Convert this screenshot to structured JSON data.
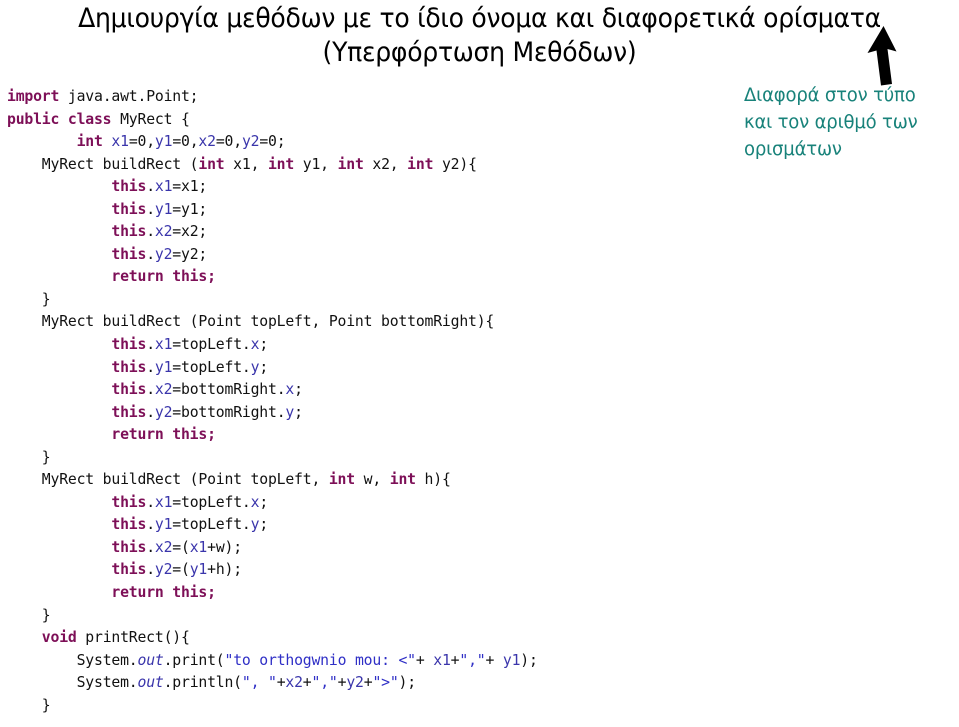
{
  "slide": {
    "title": {
      "line1": "Δημιουργία μεθόδων με το ίδιο όνομα και διαφορετικά ορίσματα",
      "line2": "(Υπερφόρτωση Μεθόδων)"
    },
    "annotation": {
      "line1": "Διαφορά στον τύπο",
      "line2": "και τον αριθμό των",
      "line3": "ορισμάτων",
      "color": "#18827a"
    },
    "arrow": {
      "icon": "arrow-up-icon",
      "color": "#000000"
    }
  },
  "code": {
    "language": "java",
    "colors": {
      "keyword": "#7d0f57",
      "variable": "#3a35ab",
      "string": "#2f2fc6",
      "plain": "#111111"
    },
    "lines": [
      {
        "indent": 0,
        "tokens": [
          {
            "t": "kw",
            "v": "import"
          },
          {
            "t": "plain",
            "v": " java.awt.Point;"
          }
        ]
      },
      {
        "indent": 0,
        "tokens": [
          {
            "t": "kw",
            "v": "public class"
          },
          {
            "t": "plain",
            "v": " MyRect {"
          }
        ]
      },
      {
        "indent": 2,
        "tokens": [
          {
            "t": "kw",
            "v": "int"
          },
          {
            "t": "plain",
            "v": " "
          },
          {
            "t": "var",
            "v": "x1"
          },
          {
            "t": "plain",
            "v": "=0,"
          },
          {
            "t": "var",
            "v": "y1"
          },
          {
            "t": "plain",
            "v": "=0,"
          },
          {
            "t": "var",
            "v": "x2"
          },
          {
            "t": "plain",
            "v": "=0,"
          },
          {
            "t": "var",
            "v": "y2"
          },
          {
            "t": "plain",
            "v": "=0;"
          }
        ]
      },
      {
        "indent": 1,
        "tokens": [
          {
            "t": "plain",
            "v": "MyRect buildRect ("
          },
          {
            "t": "kw",
            "v": "int"
          },
          {
            "t": "plain",
            "v": " x1, "
          },
          {
            "t": "kw",
            "v": "int"
          },
          {
            "t": "plain",
            "v": " y1, "
          },
          {
            "t": "kw",
            "v": "int"
          },
          {
            "t": "plain",
            "v": " x2, "
          },
          {
            "t": "kw",
            "v": "int"
          },
          {
            "t": "plain",
            "v": " y2){"
          }
        ]
      },
      {
        "indent": 3,
        "tokens": [
          {
            "t": "kw",
            "v": "this"
          },
          {
            "t": "plain",
            "v": "."
          },
          {
            "t": "var",
            "v": "x1"
          },
          {
            "t": "plain",
            "v": "=x1;"
          }
        ]
      },
      {
        "indent": 3,
        "tokens": [
          {
            "t": "kw",
            "v": "this"
          },
          {
            "t": "plain",
            "v": "."
          },
          {
            "t": "var",
            "v": "y1"
          },
          {
            "t": "plain",
            "v": "=y1;"
          }
        ]
      },
      {
        "indent": 3,
        "tokens": [
          {
            "t": "kw",
            "v": "this"
          },
          {
            "t": "plain",
            "v": "."
          },
          {
            "t": "var",
            "v": "x2"
          },
          {
            "t": "plain",
            "v": "=x2;"
          }
        ]
      },
      {
        "indent": 3,
        "tokens": [
          {
            "t": "kw",
            "v": "this"
          },
          {
            "t": "plain",
            "v": "."
          },
          {
            "t": "var",
            "v": "y2"
          },
          {
            "t": "plain",
            "v": "=y2;"
          }
        ]
      },
      {
        "indent": 3,
        "tokens": [
          {
            "t": "kw",
            "v": "return this;"
          }
        ]
      },
      {
        "indent": 1,
        "tokens": [
          {
            "t": "plain",
            "v": "}"
          }
        ]
      },
      {
        "indent": 1,
        "tokens": [
          {
            "t": "plain",
            "v": "MyRect buildRect (Point topLeft, Point bottomRight){"
          }
        ]
      },
      {
        "indent": 3,
        "tokens": [
          {
            "t": "kw",
            "v": "this"
          },
          {
            "t": "plain",
            "v": "."
          },
          {
            "t": "var",
            "v": "x1"
          },
          {
            "t": "plain",
            "v": "=topLeft."
          },
          {
            "t": "var",
            "v": "x"
          },
          {
            "t": "plain",
            "v": ";"
          }
        ]
      },
      {
        "indent": 3,
        "tokens": [
          {
            "t": "kw",
            "v": "this"
          },
          {
            "t": "plain",
            "v": "."
          },
          {
            "t": "var",
            "v": "y1"
          },
          {
            "t": "plain",
            "v": "=topLeft."
          },
          {
            "t": "var",
            "v": "y"
          },
          {
            "t": "plain",
            "v": ";"
          }
        ]
      },
      {
        "indent": 3,
        "tokens": [
          {
            "t": "kw",
            "v": "this"
          },
          {
            "t": "plain",
            "v": "."
          },
          {
            "t": "var",
            "v": "x2"
          },
          {
            "t": "plain",
            "v": "=bottomRight."
          },
          {
            "t": "var",
            "v": "x"
          },
          {
            "t": "plain",
            "v": ";"
          }
        ]
      },
      {
        "indent": 3,
        "tokens": [
          {
            "t": "kw",
            "v": "this"
          },
          {
            "t": "plain",
            "v": "."
          },
          {
            "t": "var",
            "v": "y2"
          },
          {
            "t": "plain",
            "v": "=bottomRight."
          },
          {
            "t": "var",
            "v": "y"
          },
          {
            "t": "plain",
            "v": ";"
          }
        ]
      },
      {
        "indent": 3,
        "tokens": [
          {
            "t": "kw",
            "v": "return this;"
          }
        ]
      },
      {
        "indent": 1,
        "tokens": [
          {
            "t": "plain",
            "v": "}"
          }
        ]
      },
      {
        "indent": 1,
        "tokens": [
          {
            "t": "plain",
            "v": "MyRect buildRect (Point topLeft, "
          },
          {
            "t": "kw",
            "v": "int"
          },
          {
            "t": "plain",
            "v": " w, "
          },
          {
            "t": "kw",
            "v": "int"
          },
          {
            "t": "plain",
            "v": " h){"
          }
        ]
      },
      {
        "indent": 3,
        "tokens": [
          {
            "t": "kw",
            "v": "this"
          },
          {
            "t": "plain",
            "v": "."
          },
          {
            "t": "var",
            "v": "x1"
          },
          {
            "t": "plain",
            "v": "=topLeft."
          },
          {
            "t": "var",
            "v": "x"
          },
          {
            "t": "plain",
            "v": ";"
          }
        ]
      },
      {
        "indent": 3,
        "tokens": [
          {
            "t": "kw",
            "v": "this"
          },
          {
            "t": "plain",
            "v": "."
          },
          {
            "t": "var",
            "v": "y1"
          },
          {
            "t": "plain",
            "v": "=topLeft."
          },
          {
            "t": "var",
            "v": "y"
          },
          {
            "t": "plain",
            "v": ";"
          }
        ]
      },
      {
        "indent": 3,
        "tokens": [
          {
            "t": "kw",
            "v": "this"
          },
          {
            "t": "plain",
            "v": "."
          },
          {
            "t": "var",
            "v": "x2"
          },
          {
            "t": "plain",
            "v": "=("
          },
          {
            "t": "var",
            "v": "x1"
          },
          {
            "t": "plain",
            "v": "+w);"
          }
        ]
      },
      {
        "indent": 3,
        "tokens": [
          {
            "t": "kw",
            "v": "this"
          },
          {
            "t": "plain",
            "v": "."
          },
          {
            "t": "var",
            "v": "y2"
          },
          {
            "t": "plain",
            "v": "=("
          },
          {
            "t": "var",
            "v": "y1"
          },
          {
            "t": "plain",
            "v": "+h);"
          }
        ]
      },
      {
        "indent": 3,
        "tokens": [
          {
            "t": "kw",
            "v": "return this;"
          }
        ]
      },
      {
        "indent": 1,
        "tokens": [
          {
            "t": "plain",
            "v": "}"
          }
        ]
      },
      {
        "indent": 1,
        "tokens": [
          {
            "t": "kw",
            "v": "void"
          },
          {
            "t": "plain",
            "v": " printRect(){"
          }
        ]
      },
      {
        "indent": 2,
        "tokens": [
          {
            "t": "plain",
            "v": "System."
          },
          {
            "t": "em",
            "v": "out"
          },
          {
            "t": "plain",
            "v": ".print("
          },
          {
            "t": "str",
            "v": "\"to orthogwnio mou: <\""
          },
          {
            "t": "plain",
            "v": "+ "
          },
          {
            "t": "var",
            "v": "x1"
          },
          {
            "t": "plain",
            "v": "+"
          },
          {
            "t": "str",
            "v": "\",\""
          },
          {
            "t": "plain",
            "v": "+ "
          },
          {
            "t": "var",
            "v": "y1"
          },
          {
            "t": "plain",
            "v": ");"
          }
        ]
      },
      {
        "indent": 2,
        "tokens": [
          {
            "t": "plain",
            "v": "System."
          },
          {
            "t": "em",
            "v": "out"
          },
          {
            "t": "plain",
            "v": ".println("
          },
          {
            "t": "str",
            "v": "\", \""
          },
          {
            "t": "plain",
            "v": "+"
          },
          {
            "t": "var",
            "v": "x2"
          },
          {
            "t": "plain",
            "v": "+"
          },
          {
            "t": "str",
            "v": "\",\""
          },
          {
            "t": "plain",
            "v": "+"
          },
          {
            "t": "var",
            "v": "y2"
          },
          {
            "t": "plain",
            "v": "+"
          },
          {
            "t": "str",
            "v": "\">\""
          },
          {
            "t": "plain",
            "v": ");"
          }
        ]
      },
      {
        "indent": 1,
        "tokens": [
          {
            "t": "plain",
            "v": "}"
          }
        ]
      }
    ]
  }
}
